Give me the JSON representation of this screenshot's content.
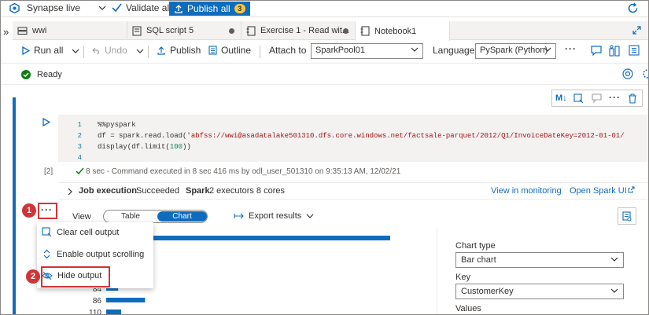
{
  "topbar": {
    "workspace": "Synapse live",
    "validate_all": "Validate all",
    "publish_all": "Publish all",
    "publish_count": "3"
  },
  "tabs": [
    {
      "label": "wwi",
      "icon": "database-icon"
    },
    {
      "label": "SQL script 5",
      "icon": "sql-script-icon",
      "modified": true
    },
    {
      "label": "Exercise 1 - Read wit...",
      "icon": "notebook-icon",
      "modified": true
    },
    {
      "label": "Notebook1",
      "icon": "notebook-icon",
      "active": true
    }
  ],
  "toolbar": {
    "run_all": "Run all",
    "undo": "Undo",
    "publish": "Publish",
    "outline": "Outline",
    "attach_to_label": "Attach to",
    "attach_to_value": "SparkPool01",
    "language_label": "Language",
    "language_value": "PySpark (Python)",
    "more": "···"
  },
  "status": {
    "text": "Ready"
  },
  "cell": {
    "exec_count": "[2]",
    "line_numbers": [
      "1",
      "2",
      "3",
      "4"
    ],
    "code": {
      "line1": "%%pyspark",
      "line2_prefix": "df = spark.read.load(",
      "line2_string": "'abfss://wwi@asadatalake501310.dfs.core.windows.net/factsale-parquet/2012/Q1/InvoiceDateKey=2012-01-01/",
      "line3_prefix": "display(df.limit(",
      "line3_num": "100",
      "line3_suffix": "))"
    },
    "exec_info": "8 sec - Command executed in 8 sec 416 ms by odl_user_501310 on 9:35:13 AM, 12/02/21"
  },
  "job": {
    "label": "Job execution",
    "state": "Succeeded",
    "spark_label": "Spark",
    "spark_detail": "2 executors 8 cores",
    "view_monitoring": "View in monitoring",
    "open_spark_ui": "Open Spark UI"
  },
  "output": {
    "more": "···",
    "view_label": "View",
    "view_table": "Table",
    "view_chart": "Chart",
    "export_results": "Export results"
  },
  "context_menu": {
    "items": [
      "Clear cell output",
      "Enable output scrolling",
      "Hide output"
    ]
  },
  "callouts": [
    "1",
    "2"
  ],
  "chart_data": {
    "type": "bar",
    "categories": [
      "84",
      "86",
      "110"
    ],
    "values": [
      4,
      13,
      5
    ],
    "top_bar_value": 95,
    "xlim": [
      0,
      100
    ]
  },
  "chart_options": {
    "chart_type_label": "Chart type",
    "chart_type_value": "Bar chart",
    "key_label": "Key",
    "key_value": "CustomerKey",
    "values_label": "Values"
  },
  "colors": {
    "accent": "#0f6cbd",
    "callout": "#d13438",
    "success": "#107c10",
    "badge": "#f3c63f"
  }
}
